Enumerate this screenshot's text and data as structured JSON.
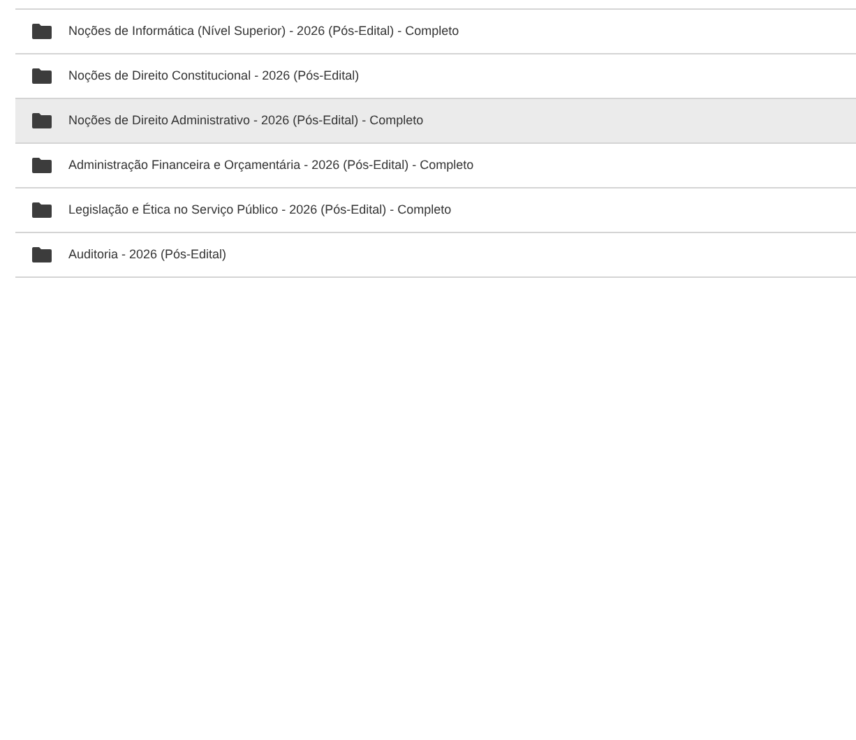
{
  "folders": [
    {
      "name": "Noções de Informática (Nível Superior) - 2026 (Pós-Edital) - Completo",
      "selected": false
    },
    {
      "name": "Noções de Direito Constitucional - 2026 (Pós-Edital)",
      "selected": false
    },
    {
      "name": "Noções de Direito Administrativo - 2026 (Pós-Edital) - Completo",
      "selected": true
    },
    {
      "name": "Administração Financeira e Orçamentária - 2026 (Pós-Edital) - Completo",
      "selected": false
    },
    {
      "name": "Legislação e Ética no Serviço Público - 2026 (Pós-Edital) - Completo",
      "selected": false
    },
    {
      "name": "Auditoria - 2026 (Pós-Edital)",
      "selected": false
    }
  ]
}
